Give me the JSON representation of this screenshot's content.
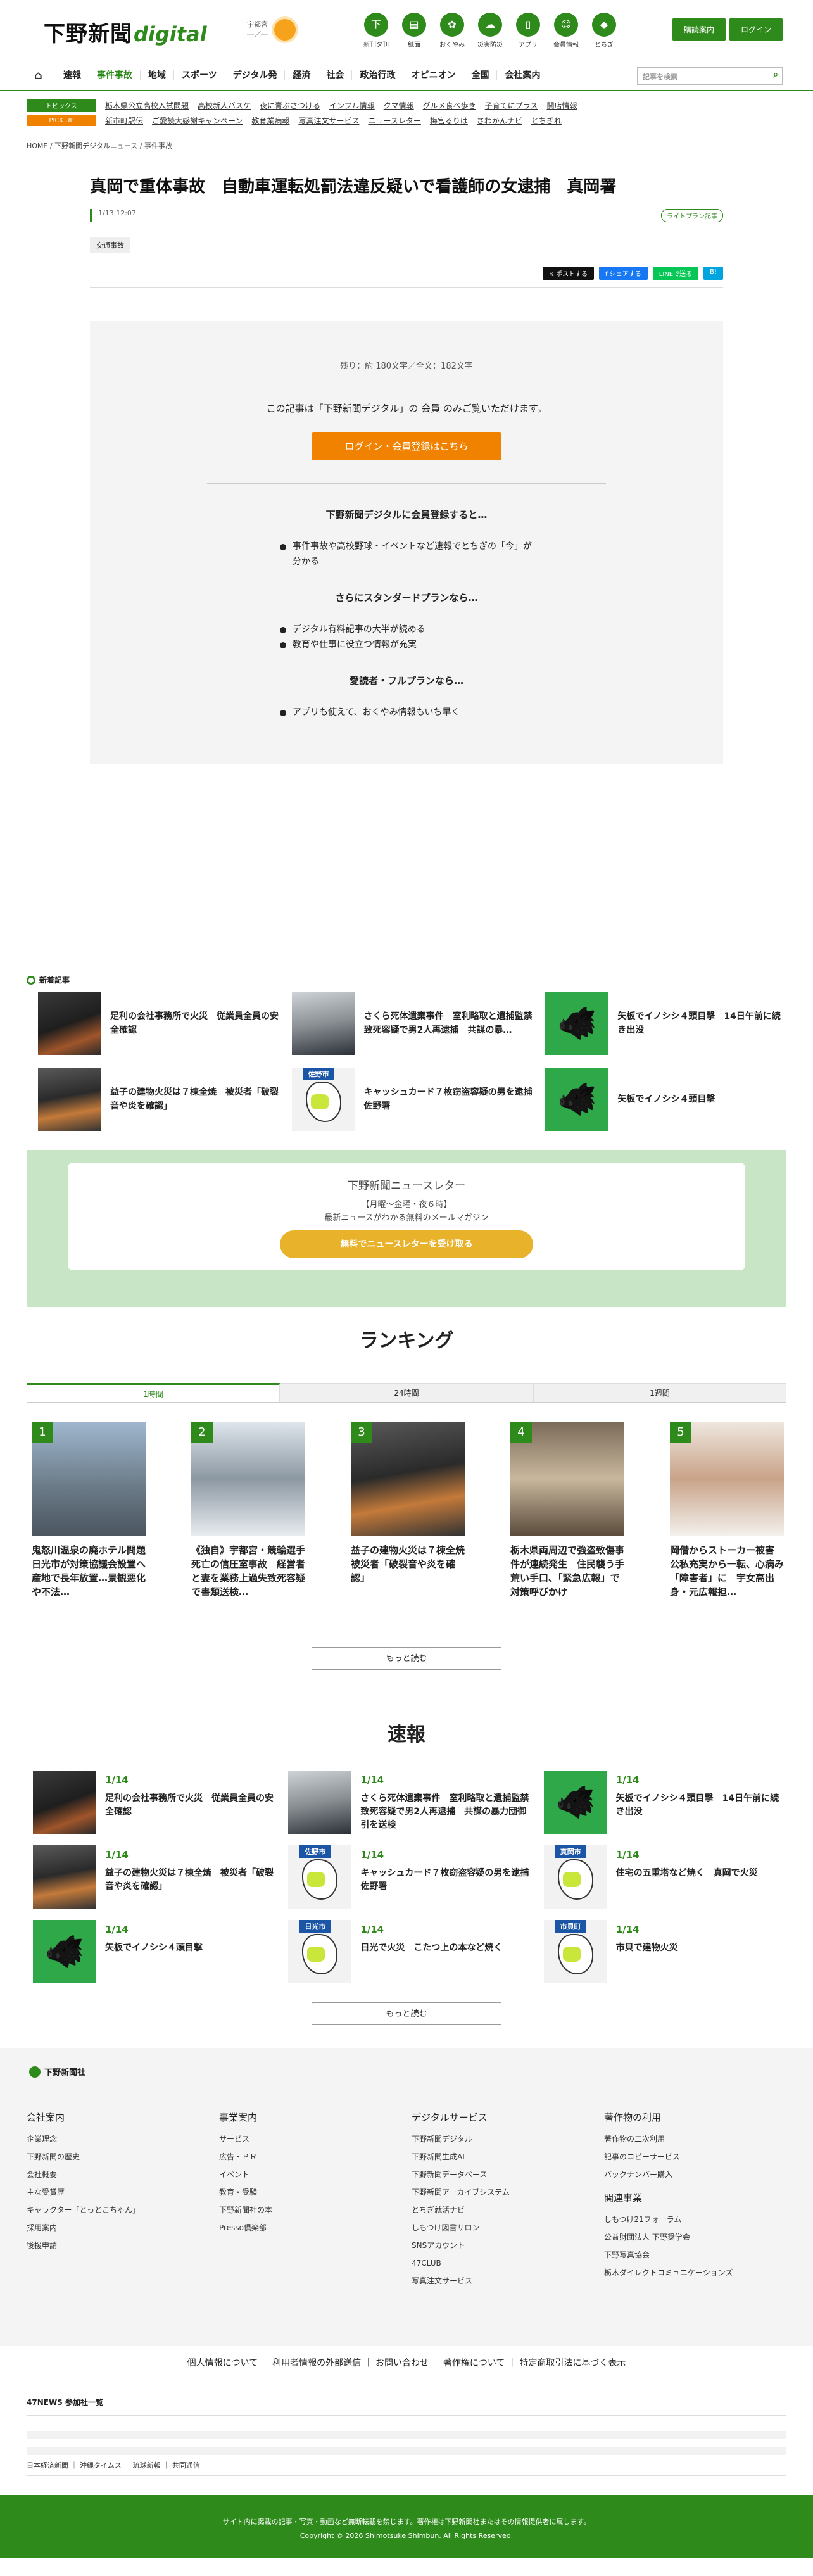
{
  "header": {
    "logo_ja": "下野新聞",
    "logo_en": "digital",
    "logo_sub": "デジタル",
    "weather_area": "宇都宮",
    "weather_temp": "―／―",
    "quick_links": [
      {
        "icon": "newspaper-icon",
        "label": "新刊夕刊",
        "glyph": "下"
      },
      {
        "icon": "paper-icon",
        "label": "紙面",
        "glyph": "▤"
      },
      {
        "icon": "condolence-icon",
        "label": "おくやみ",
        "glyph": "✿"
      },
      {
        "icon": "cloud-icon",
        "label": "災害防災",
        "glyph": "☁"
      },
      {
        "icon": "phone-icon",
        "label": "アプリ",
        "glyph": "▯"
      },
      {
        "icon": "member-icon",
        "label": "会員情報",
        "glyph": "☺"
      },
      {
        "icon": "tochigi-icon",
        "label": "とちぎ",
        "glyph": "◆"
      }
    ],
    "subscribe_label": "購読案内",
    "login_label": "ログイン"
  },
  "nav": {
    "items": [
      "速報",
      "事件事故",
      "地域",
      "スポーツ",
      "デジタル発",
      "経済",
      "社会",
      "政治行政",
      "オピニオン",
      "全国",
      "会社案内"
    ],
    "active": "事件事故",
    "search_placeholder": "記事を検索"
  },
  "subnav": {
    "topics_tag": "トピックス",
    "topics": [
      "栃木県公立高校入試問題",
      "高校新人バスケ",
      "夜に青ぶさつける",
      "インフル情報",
      "クマ情報",
      "グルメ食べ歩き",
      "子育てにプラス",
      "開店情報"
    ],
    "pickup_tag": "PICK UP",
    "pickup": [
      "新市町駅伝",
      "ご愛読大感謝キャンペーン",
      "教育業病報",
      "写真注文サービス",
      "ニュースレター",
      "梅宮るりは",
      "さわかんナビ",
      "とちぎれ"
    ]
  },
  "breadcrumb": [
    "HOME",
    "下野新聞デジタルニュース",
    "事件事故"
  ],
  "article": {
    "title": "真岡で重体事故　自動車運転処罰法違反疑いで看護師の女逮捕　真岡署",
    "date": "1/13 12:07",
    "plan_badge": "ライトプラン記事",
    "category": "交通事故",
    "share": [
      "𝕏 ポストする",
      "f シェアする",
      "LINEで送る",
      "B!"
    ]
  },
  "paywall": {
    "count": "残り：約 180文字／全文：182文字",
    "message": "この記事は「下野新聞デジタル」の 会員 のみご覧いただけます。",
    "login_button": "ログイン・会員登録はこちら",
    "benefit_title": "下野新聞デジタルに会員登録すると…",
    "benefits": [
      "事件事故や高校野球・イベントなど速報でとちぎの「今」が分かる"
    ],
    "standard_title": "さらにスタンダードプランなら…",
    "standard": [
      "デジタル有料記事の大半が読める",
      "教育や仕事に役立つ情報が充実"
    ],
    "full_title": "愛読者・フルプランなら…",
    "full": [
      "アプリも使えて、おくやみ情報もいち早く"
    ]
  },
  "new_articles": {
    "heading": "新着記事",
    "items": [
      {
        "title": "足利の会社事務所で火災　従業員全員の安全確認",
        "thumb": "fire"
      },
      {
        "title": "さくら死体遺棄事件　室利略取と遺捕監禁致死容疑で男2人再逮捕　共謀の暴…",
        "thumb": "police"
      },
      {
        "title": "矢板でイノシシ４頭目撃　14日午前に続き出没",
        "thumb": "boar"
      },
      {
        "title": "益子の建物火災は７棟全焼　被災者「破裂音や炎を確認」",
        "thumb": "fire2"
      },
      {
        "title": "キャッシュカード７枚窃盗容疑の男を逮捕　佐野署",
        "thumb": "map",
        "map_label": "佐野市"
      },
      {
        "title": "矢板でイノシシ４頭目撃",
        "thumb": "boar"
      }
    ]
  },
  "newsletter": {
    "title": "下野新聞ニュースレター",
    "schedule": "【月曜〜金曜・夜６時】",
    "desc": "最新ニュースがわかる無料のメールマガジン",
    "button": "無料でニュースレターを受け取る"
  },
  "ranking": {
    "heading": "ランキング",
    "tabs": [
      "1時間",
      "24時間",
      "1週間"
    ],
    "active_tab": "1時間",
    "items": [
      {
        "rank": "1",
        "title": "鬼怒川温泉の廃ホテル問題　日光市が対策協議会設置へ　産地で長年放置…景観悪化や不法…",
        "thumb": "building"
      },
      {
        "rank": "2",
        "title": "《独自》宇都宮・競輪選手死亡の信圧室事故　経営者と妻を業務上過失致死容疑で書類送検…",
        "thumb": "house"
      },
      {
        "rank": "3",
        "title": "益子の建物火災は７棟全焼　被災者「破裂音や炎を確認」",
        "thumb": "fire2"
      },
      {
        "rank": "4",
        "title": "栃木県両周辺で強盗致傷事件が連続発生　住民襲う手荒い手口、「緊急広報」で対策呼びかけ",
        "thumb": "shop"
      },
      {
        "rank": "5",
        "title": "岡借からストーカー被害　公私充実から一転、心病み「障害者」に　宇女高出身・元広報担…",
        "thumb": "person"
      }
    ],
    "more": "もっと読む"
  },
  "sokuho": {
    "heading": "速報",
    "items": [
      {
        "date": "1/14",
        "title": "足利の会社事務所で火災　従業員全員の安全確認",
        "thumb": "fire"
      },
      {
        "date": "1/14",
        "title": "さくら死体遺棄事件　室利略取と遺捕監禁致死容疑で男2人再逮捕　共謀の暴力団御引を送検",
        "thumb": "police"
      },
      {
        "date": "1/14",
        "title": "矢板でイノシシ４頭目撃　14日午前に続き出没",
        "thumb": "boar"
      },
      {
        "date": "1/14",
        "title": "益子の建物火災は７棟全焼　被災者「破裂音や炎を確認」",
        "thumb": "fire2"
      },
      {
        "date": "1/14",
        "title": "キャッシュカード７枚窃盗容疑の男を逮捕　佐野署",
        "thumb": "map",
        "map_label": "佐野市"
      },
      {
        "date": "1/14",
        "title": "住宅の五重塔など焼く　真岡で火災",
        "thumb": "map",
        "map_label": "真岡市"
      },
      {
        "date": "1/14",
        "title": "矢板でイノシシ４頭目撃",
        "thumb": "boar"
      },
      {
        "date": "1/14",
        "title": "日光で火災　こたつ上の本など焼く",
        "thumb": "map",
        "map_label": "日光市"
      },
      {
        "date": "1/14",
        "title": "市貝で建物火災",
        "thumb": "map",
        "map_label": "市貝町"
      }
    ],
    "more": "もっと読む"
  },
  "footer": {
    "logo": "下野新聞社",
    "cols": [
      {
        "title": "会社案内",
        "items": [
          "企業理念",
          "下野新聞の歴史",
          "会社概要",
          "主な受賞歴",
          "キャラクター「とっとこちゃん」",
          "採用案内",
          "後援申請"
        ]
      },
      {
        "title": "事業案内",
        "items": [
          "サービス",
          "広告・ＰＲ",
          "イベント",
          "教育・受験",
          "下野新聞社の本",
          "Presso倶楽部"
        ]
      },
      {
        "title": "デジタルサービス",
        "items": [
          "下野新聞デジタル",
          "下野新聞生成AI",
          "下野新聞データベース",
          "下野新聞アーカイブシステム",
          "とちぎ就活ナビ",
          "しもつけ図書サロン",
          "SNSアカウント",
          "47CLUB",
          "写真注文サービス"
        ]
      },
      {
        "title": "著作物の利用",
        "items": [
          "著作物の二次利用",
          "記事のコピーサービス",
          "バックナンバー購入"
        ],
        "sub_title": "関連事業",
        "sub_items": [
          "しもつけ21フォーラム",
          "公益財団法人 下野奨学会",
          "下野写真協会",
          "栃木ダイレクトコミュニケーションズ"
        ]
      }
    ],
    "links": "個人情報について ｜ 利用者情報の外部送信 ｜ お問い合わせ ｜ 著作権について ｜ 特定商取引法に基づく表示",
    "n47_title": "47NEWS 参加社一覧",
    "n47_row": "日本経済新聞 ｜ 沖縄タイムス ｜ 琉球新報 ｜ 共同通信",
    "copy1": "サイト内に掲載の記事・写真・動画など無断転載を禁じます。著作権は下野新聞社またはその情報提供者に属します。",
    "copy2": "Copyright © 2026 Shimotsuke Shimbun. All Rights Reserved."
  },
  "colors": {
    "brand": "#2f8a1c",
    "accent": "#f08200",
    "newsletter_bg": "#c8e6c5"
  }
}
